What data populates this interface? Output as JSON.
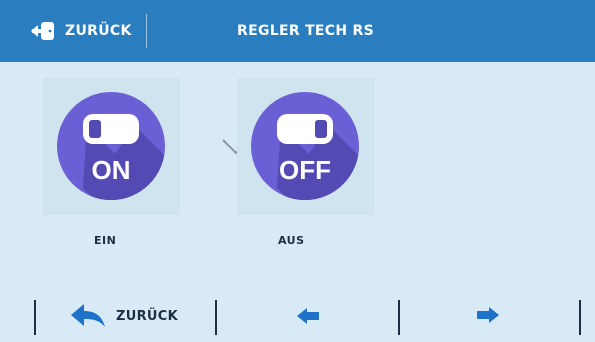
{
  "header": {
    "back_label": "ZURÜCK",
    "title": "REGLER TECH RS"
  },
  "options": [
    {
      "badge": "ON",
      "label": "EIN",
      "selected": false
    },
    {
      "badge": "OFF",
      "label": "AUS",
      "selected": true
    }
  ],
  "footer": {
    "back_label": "ZURÜCK"
  },
  "colors": {
    "header_bg": "#2a7ec0",
    "page_bg": "#d7eaf5",
    "circle": "#6b5fd6",
    "circle_shadow": "#534ab3",
    "text_dark": "#1d2f45",
    "accent_blue": "#1e73c8"
  }
}
